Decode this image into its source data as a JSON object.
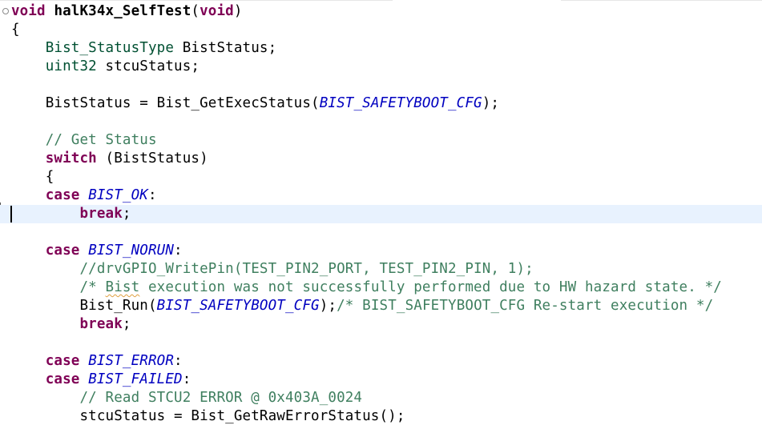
{
  "editor": {
    "language": "c",
    "fold_marker": "⊖",
    "lines": [
      {
        "tokens": [
          {
            "t": "kw",
            "v": "void"
          },
          {
            "t": "id",
            "v": " "
          },
          {
            "t": "bold",
            "v": "halK34x_SelfTest"
          },
          {
            "t": "id",
            "v": "("
          },
          {
            "t": "kw",
            "v": "void"
          },
          {
            "t": "id",
            "v": ")"
          }
        ],
        "fold": true
      },
      {
        "tokens": [
          {
            "t": "id",
            "v": "{"
          }
        ]
      },
      {
        "tokens": [
          {
            "t": "ty",
            "v": "    Bist_StatusType"
          },
          {
            "t": "id",
            "v": " BistStatus;"
          }
        ]
      },
      {
        "tokens": [
          {
            "t": "ty",
            "v": "    uint32"
          },
          {
            "t": "id",
            "v": " stcuStatus;"
          }
        ]
      },
      {
        "tokens": []
      },
      {
        "tokens": [
          {
            "t": "id",
            "v": "    BistStatus = Bist_GetExecStatus("
          },
          {
            "t": "en",
            "v": "BIST_SAFETYBOOT_CFG"
          },
          {
            "t": "id",
            "v": ");"
          }
        ]
      },
      {
        "tokens": []
      },
      {
        "tokens": [
          {
            "t": "cm",
            "v": "    // Get Status"
          }
        ]
      },
      {
        "tokens": [
          {
            "t": "kw",
            "v": "    switch"
          },
          {
            "t": "id",
            "v": " (BistStatus)"
          }
        ]
      },
      {
        "tokens": [
          {
            "t": "id",
            "v": "    {"
          }
        ]
      },
      {
        "tokens": [
          {
            "t": "kw",
            "v": "    case"
          },
          {
            "t": "id",
            "v": " "
          },
          {
            "t": "en",
            "v": "BIST_OK"
          },
          {
            "t": "id",
            "v": ":"
          }
        ]
      },
      {
        "tokens": [
          {
            "t": "kw",
            "v": "        break"
          },
          {
            "t": "id",
            "v": ";"
          }
        ],
        "current": true
      },
      {
        "tokens": []
      },
      {
        "tokens": [
          {
            "t": "kw",
            "v": "    case"
          },
          {
            "t": "id",
            "v": " "
          },
          {
            "t": "en",
            "v": "BIST_NORUN"
          },
          {
            "t": "id",
            "v": ":"
          }
        ]
      },
      {
        "tokens": [
          {
            "t": "cm",
            "v": "        //drvGPIO_WritePin(TEST_PIN2_PORT, TEST_PIN2_PIN, 1);"
          }
        ]
      },
      {
        "tokens": [
          {
            "t": "cm",
            "v": "        /* "
          },
          {
            "t": "cmsq",
            "v": "Bist"
          },
          {
            "t": "cm",
            "v": " execution was not successfully performed due to HW hazard state. */"
          }
        ]
      },
      {
        "tokens": [
          {
            "t": "id",
            "v": "        Bist_Run("
          },
          {
            "t": "en",
            "v": "BIST_SAFETYBOOT_CFG"
          },
          {
            "t": "id",
            "v": ");"
          },
          {
            "t": "cm",
            "v": "/* BIST_SAFETYBOOT_CFG Re-start execution */"
          }
        ]
      },
      {
        "tokens": [
          {
            "t": "kw",
            "v": "        break"
          },
          {
            "t": "id",
            "v": ";"
          }
        ]
      },
      {
        "tokens": []
      },
      {
        "tokens": [
          {
            "t": "kw",
            "v": "    case"
          },
          {
            "t": "id",
            "v": " "
          },
          {
            "t": "en",
            "v": "BIST_ERROR"
          },
          {
            "t": "id",
            "v": ":"
          }
        ]
      },
      {
        "tokens": [
          {
            "t": "kw",
            "v": "    case"
          },
          {
            "t": "id",
            "v": " "
          },
          {
            "t": "en",
            "v": "BIST_FAILED"
          },
          {
            "t": "id",
            "v": ":"
          }
        ]
      },
      {
        "tokens": [
          {
            "t": "cm",
            "v": "        // Read STCU2 ERROR @ 0x403A_0024"
          }
        ]
      },
      {
        "tokens": [
          {
            "t": "id",
            "v": "        stcuStatus = Bist_GetRawErrorStatus();"
          }
        ]
      }
    ]
  }
}
